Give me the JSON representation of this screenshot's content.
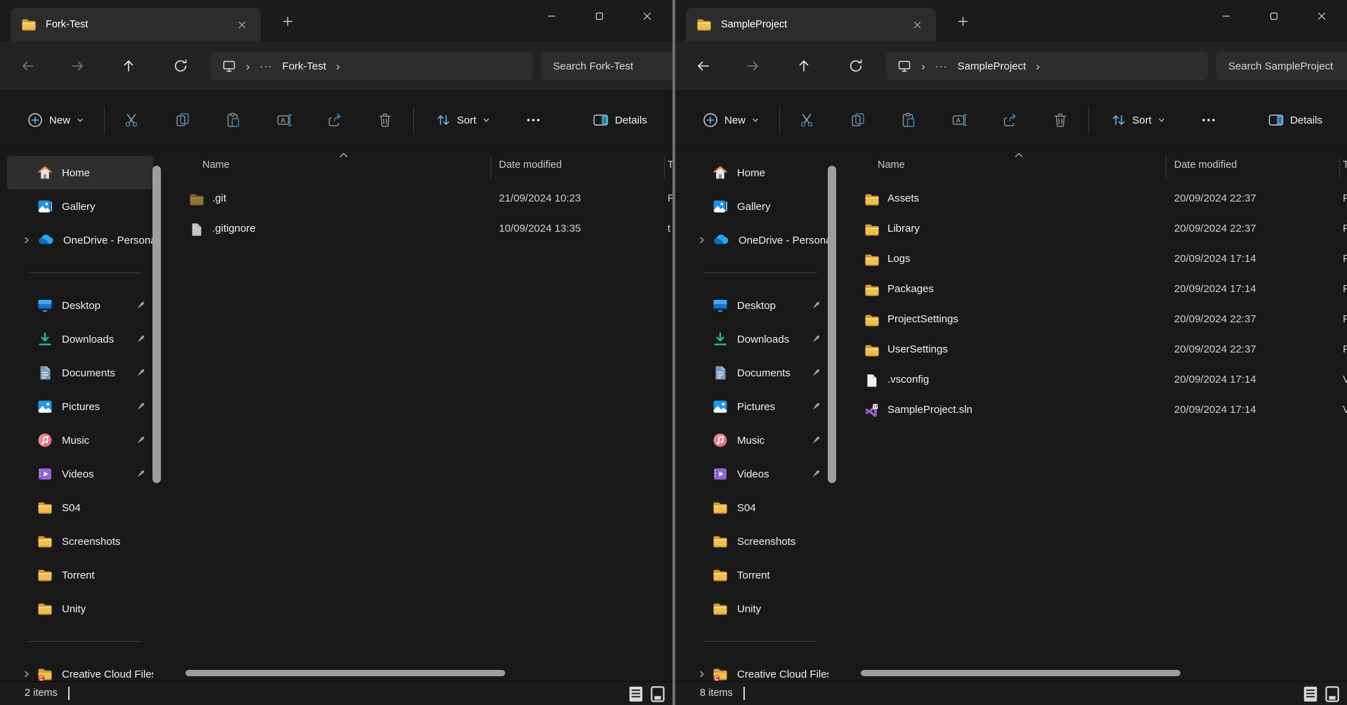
{
  "address": {
    "chevron": "›",
    "overflow": "···"
  },
  "tabbar": {
    "new_tab_icon": "plus",
    "tab_close_icon": "close"
  },
  "toolbar": {
    "new_label": "New",
    "sort_label": "Sort",
    "details_label": "Details",
    "buttons": [
      "cut",
      "copy",
      "paste",
      "rename",
      "share",
      "delete"
    ],
    "ellipsis_icon": "more-ellipsis"
  },
  "columns": {
    "name": "Name",
    "date_modified": "Date modified",
    "type_partial": "T"
  },
  "sidebar": {
    "top_items": [
      {
        "label": "Home",
        "icon": "home",
        "expandable": false,
        "pinned": false
      },
      {
        "label": "Gallery",
        "icon": "gallery",
        "expandable": false,
        "pinned": false
      },
      {
        "label": "OneDrive - Personal",
        "icon": "onedrive",
        "expandable": true,
        "pinned": false
      }
    ],
    "pinned_items": [
      {
        "label": "Desktop",
        "icon": "desktop",
        "expandable": false,
        "pinned": true
      },
      {
        "label": "Downloads",
        "icon": "downloads",
        "expandable": false,
        "pinned": true
      },
      {
        "label": "Documents",
        "icon": "documents",
        "expandable": false,
        "pinned": true
      },
      {
        "label": "Pictures",
        "icon": "pictures",
        "expandable": false,
        "pinned": true
      },
      {
        "label": "Music",
        "icon": "music",
        "expandable": false,
        "pinned": true
      },
      {
        "label": "Videos",
        "icon": "videos",
        "expandable": false,
        "pinned": true
      },
      {
        "label": "S04",
        "icon": "folder",
        "expandable": false,
        "pinned": false
      },
      {
        "label": "Screenshots",
        "icon": "folder",
        "expandable": false,
        "pinned": false
      },
      {
        "label": "Torrent",
        "icon": "folder",
        "expandable": false,
        "pinned": false
      },
      {
        "label": "Unity",
        "icon": "folder",
        "expandable": false,
        "pinned": false
      }
    ],
    "bottom_items": [
      {
        "label": "Creative Cloud Files",
        "icon": "creative-cloud-folder",
        "expandable": true,
        "pinned": false
      }
    ]
  },
  "windows": [
    {
      "title": "Fork-Test",
      "breadcrumb": "Fork-Test",
      "search_placeholder": "Search Fork-Test",
      "back_enabled": false,
      "forward_enabled": false,
      "home_selected": true,
      "status": "2 items",
      "files": [
        {
          "name": ".git",
          "icon": "folder-hidden",
          "date": "21/09/2024 10:23",
          "type_partial": "F"
        },
        {
          "name": ".gitignore",
          "icon": "file-hidden",
          "date": "10/09/2024 13:35",
          "type_partial": "t"
        }
      ]
    },
    {
      "title": "SampleProject",
      "breadcrumb": "SampleProject",
      "search_placeholder": "Search SampleProject",
      "back_enabled": true,
      "forward_enabled": false,
      "home_selected": false,
      "status": "8 items",
      "files": [
        {
          "name": "Assets",
          "icon": "folder",
          "date": "20/09/2024 22:37",
          "type_partial": "F"
        },
        {
          "name": "Library",
          "icon": "folder",
          "date": "20/09/2024 22:37",
          "type_partial": "F"
        },
        {
          "name": "Logs",
          "icon": "folder",
          "date": "20/09/2024 17:14",
          "type_partial": "F"
        },
        {
          "name": "Packages",
          "icon": "folder",
          "date": "20/09/2024 17:14",
          "type_partial": "F"
        },
        {
          "name": "ProjectSettings",
          "icon": "folder",
          "date": "20/09/2024 22:37",
          "type_partial": "F"
        },
        {
          "name": "UserSettings",
          "icon": "folder",
          "date": "20/09/2024 22:37",
          "type_partial": "F"
        },
        {
          "name": ".vsconfig",
          "icon": "file",
          "date": "20/09/2024 17:14",
          "type_partial": "V"
        },
        {
          "name": "SampleProject.sln",
          "icon": "visual-studio",
          "date": "20/09/2024 17:14",
          "type_partial": "V"
        }
      ]
    }
  ]
}
